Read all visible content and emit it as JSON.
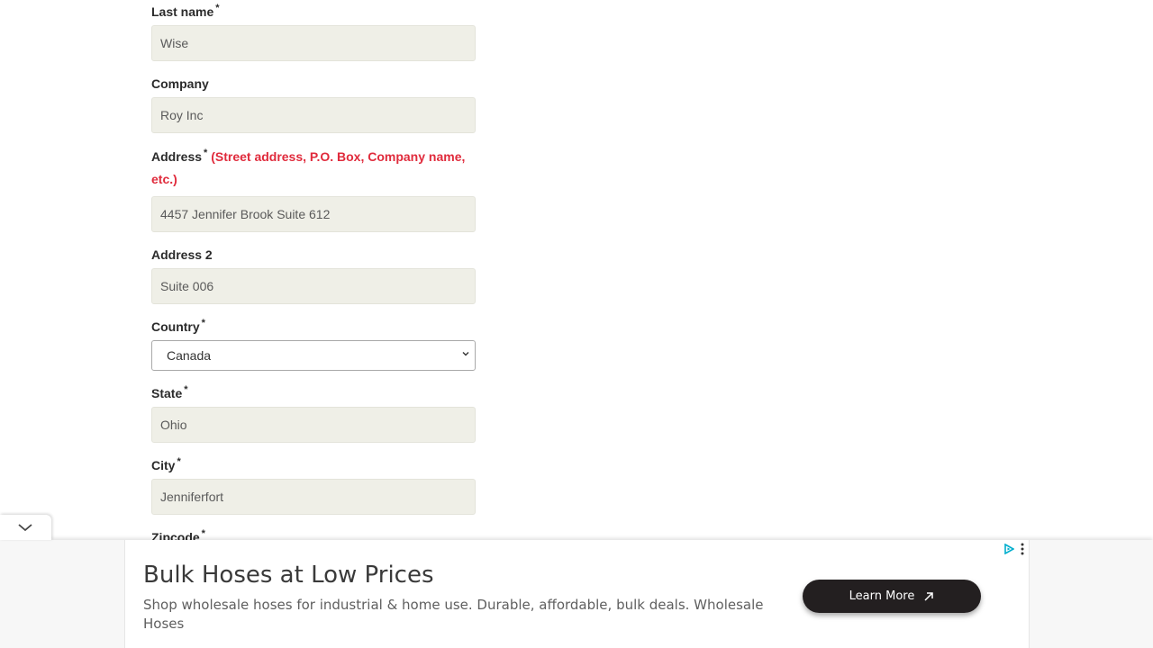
{
  "form": {
    "last_name": {
      "label": "Last name",
      "required": "*",
      "value": "Wise"
    },
    "company": {
      "label": "Company",
      "value": "Roy Inc"
    },
    "address": {
      "label": "Address",
      "required": "*",
      "hint": "(Street address, P.O. Box, Company name, etc.)",
      "value": "4457 Jennifer Brook Suite 612"
    },
    "address2": {
      "label": "Address 2",
      "value": "Suite 006"
    },
    "country": {
      "label": "Country",
      "required": "*",
      "selected": "Canada"
    },
    "state": {
      "label": "State",
      "required": "*",
      "value": "Ohio"
    },
    "city": {
      "label": "City",
      "required": "*",
      "value": "Jenniferfort"
    },
    "zipcode": {
      "label": "Zipcode",
      "required": "*"
    }
  },
  "ad": {
    "headline": "Bulk Hoses at Low Prices",
    "body": "Shop wholesale hoses for industrial & home use. Durable, affordable, bulk deals. Wholesale Hoses",
    "cta_label": "Learn More",
    "icons": {
      "collapse": "chevron-down-icon",
      "adchoices": "adchoices-icon",
      "menu": "kebab-menu-icon",
      "cta": "arrow-up-right-icon"
    },
    "colors": {
      "cta_background": "#231f20",
      "adchoices": "#00aecd"
    }
  },
  "colors": {
    "input_background": "#efefe7",
    "hint_text": "#e02b3c"
  }
}
